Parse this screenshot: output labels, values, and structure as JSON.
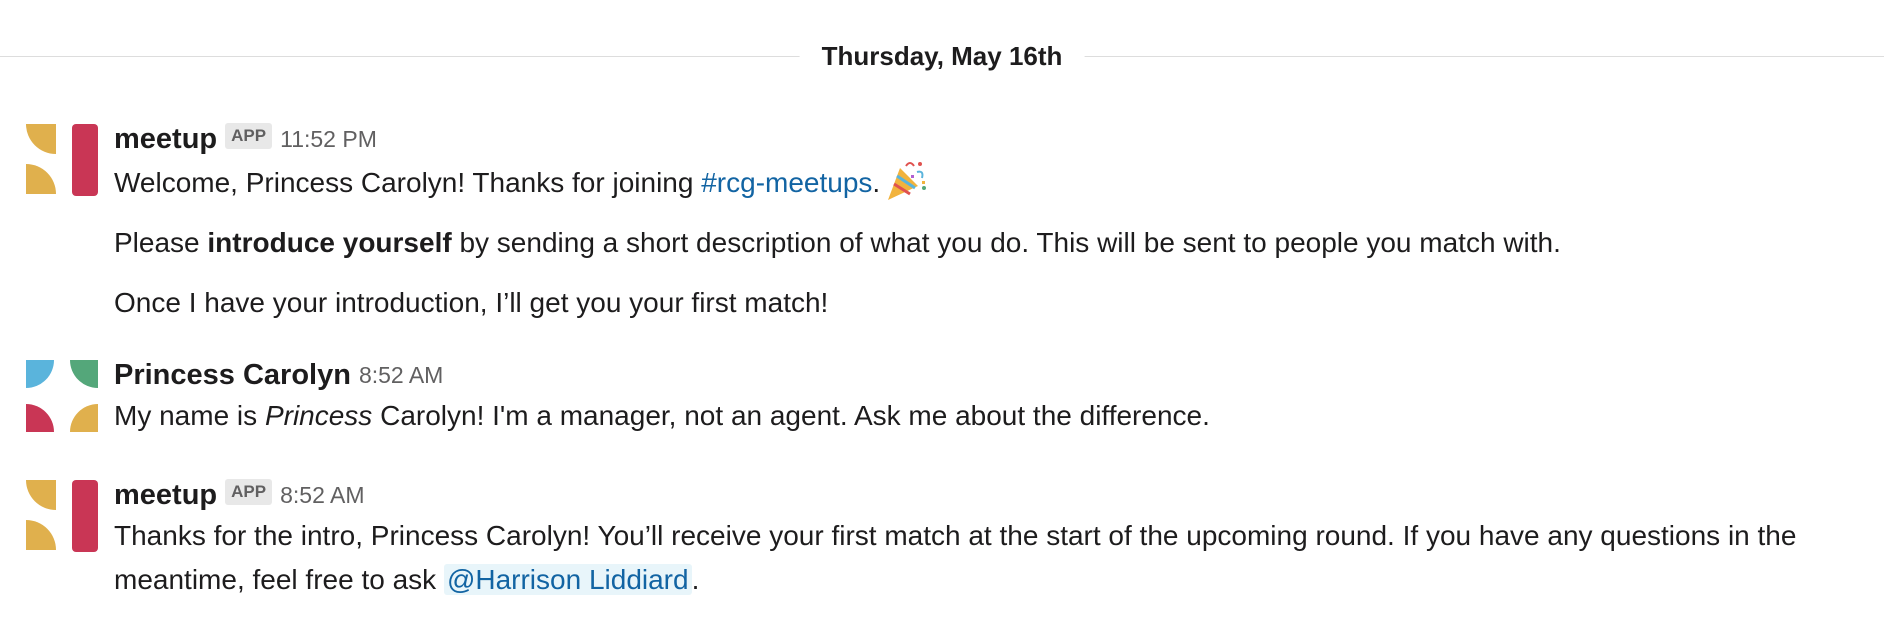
{
  "day_divider": {
    "label": "Thursday, May 16th"
  },
  "colors": {
    "link": "#1264a3",
    "mention_bg": "#e8f5fa",
    "avatar_yellow": "#e0b04d",
    "avatar_red": "#c93655",
    "avatar_blue": "#5ab4dc",
    "avatar_green": "#54a77a"
  },
  "messages": [
    {
      "sender": "meetup",
      "badge": "APP",
      "time": "11:52 PM",
      "avatar": "meetup-logo",
      "line1_before": "Welcome, Princess Carolyn! Thanks for joining ",
      "channel": "#rcg-meetups",
      "line1_after": ".",
      "emoji": "party-popper-icon",
      "line2_before": "Please ",
      "line2_bold": "introduce yourself",
      "line2_after": " by sending a short description of what you do. This will be sent to people you match with.",
      "line3": "Once I have your introduction, I’ll get you your first match!"
    },
    {
      "sender": "Princess Carolyn",
      "time": "8:52 AM",
      "avatar": "user-avatar-quarter-circles",
      "text_before": "My name is ",
      "text_italic": "Princess",
      "text_after": " Carolyn! I'm a manager, not an agent. Ask me about the difference."
    },
    {
      "sender": "meetup",
      "badge": "APP",
      "time": "8:52 AM",
      "avatar": "meetup-logo",
      "text_before": "Thanks for the intro, Princess Carolyn! You’ll receive your first match at the start of the upcoming round. If you have any questions in the meantime, feel free to ask ",
      "mention": "@Harrison Liddiard",
      "text_after": "."
    }
  ]
}
